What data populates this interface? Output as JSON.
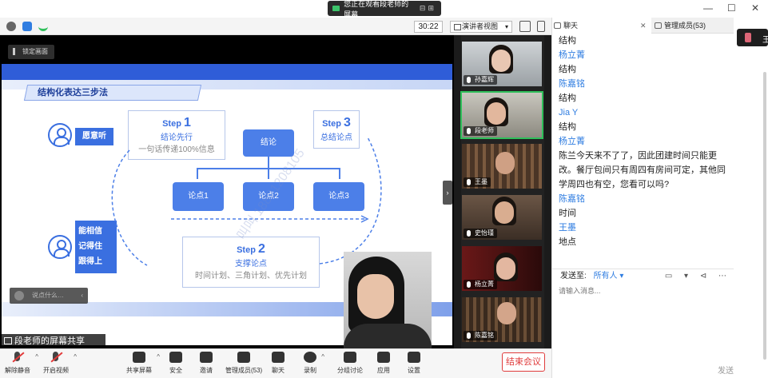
{
  "window": {
    "share_banner": "您正在观看段老师的屏幕",
    "minimize": "—",
    "maximize": "☐",
    "close": "✕"
  },
  "meeting_toolbar": {
    "timer": "30:22",
    "view_mode": "演讲者视图"
  },
  "stage": {
    "lock_button": "锁定画面",
    "slide": {
      "section_title": "结构化表达三步法",
      "box_left_top": "愿意听",
      "box_left_bottom": [
        "能相信",
        "记得住",
        "跟得上"
      ],
      "step1": {
        "label": "Step",
        "num": "1",
        "title": "结论先行",
        "desc": "一句话传递100%信息"
      },
      "step2": {
        "label": "Step",
        "num": "2",
        "title": "支撑论点",
        "desc": "时间计划、三角计划、优先计划"
      },
      "step3": {
        "label": "Step",
        "num": "3",
        "title": "总结论点"
      },
      "conclusion": "结论",
      "points": [
        "论点1",
        "论点2",
        "论点3"
      ],
      "watermark": "叫叫 18821208105"
    },
    "chat_mini": "说点什么…",
    "chat_mini_caret": "‹",
    "share_label": "段老师的屏幕共享"
  },
  "participants": [
    {
      "name": "孙嘉辉"
    },
    {
      "name": "段老师"
    },
    {
      "name": "王墨"
    },
    {
      "name": "史怡瑾"
    },
    {
      "name": "杨立菁"
    },
    {
      "name": "陈嘉铭"
    }
  ],
  "collapse_arrow": "›",
  "bottom_toolbar": {
    "unmute": "解除静音",
    "start_video": "开启视频",
    "share_screen": "共享屏幕",
    "security": "安全",
    "invite": "邀请",
    "manage": "管理成员(53)",
    "chat": "聊天",
    "record": "录制",
    "breakout": "分组讨论",
    "apps": "应用",
    "settings": "设置",
    "end_meeting": "结束会议",
    "caret": "^"
  },
  "chat": {
    "tab_chat": "聊天",
    "tab_members": "管理成员(53)",
    "tab_close": "✕",
    "messages": [
      {
        "text": "结构"
      },
      {
        "from": "杨立菁",
        "text": "结构"
      },
      {
        "from": "陈嘉铭",
        "text": "结构"
      },
      {
        "from": "Jia Y",
        "text": "结构"
      },
      {
        "from": "杨立菁",
        "text": "陈兰今天来不了了，因此团建时间只能更改。餐厅包间只有周四有房间可定，其他同学周四也有空，您看可以吗?"
      },
      {
        "from": "陈嘉铭",
        "text": "时间"
      },
      {
        "from": "王墨",
        "text": "地点"
      }
    ],
    "send_to_label": "发送至:",
    "send_to_value": "所有人",
    "send_tools": "▭ ▾ ⊲ ⋯",
    "input_placeholder": "请输入消息...",
    "send_button": "发送(S)"
  },
  "right_strip": {
    "pip_text": "王"
  }
}
